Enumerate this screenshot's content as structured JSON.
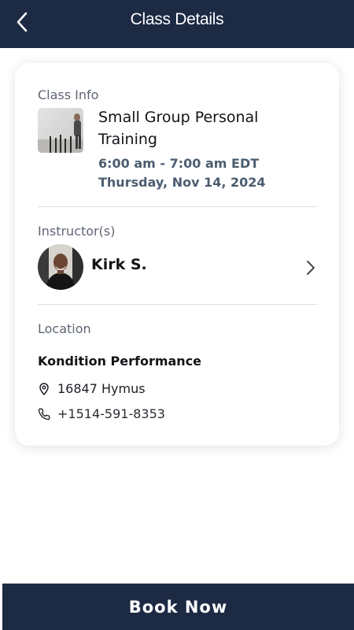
{
  "header": {
    "title": "Class Details",
    "back_icon": "chevron-left-icon"
  },
  "class_info": {
    "section_label": "Class Info",
    "title": "Small Group Personal Training",
    "time": "6:00 am - 7:00 am EDT",
    "date": "Thursday, Nov 14, 2024"
  },
  "instructors": {
    "section_label": "Instructor(s)",
    "items": [
      {
        "name": "Kirk S."
      }
    ]
  },
  "location": {
    "section_label": "Location",
    "name": "Kondition Performance",
    "address": "16847 Hymus",
    "phone": "+1514-591-8353"
  },
  "actions": {
    "book_label": "Book Now"
  },
  "colors": {
    "header_bg": "#1d2a44",
    "accent_text": "#4b5d70",
    "label_text": "#5e6673"
  }
}
